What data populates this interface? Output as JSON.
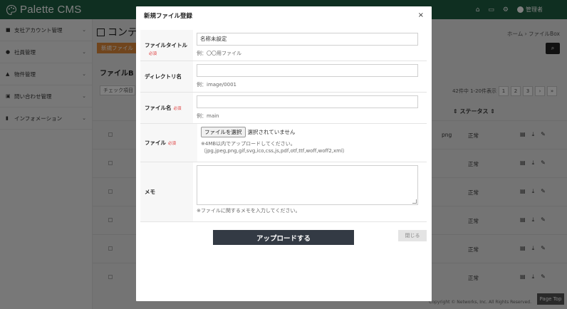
{
  "app": {
    "brand": "Palette CMS"
  },
  "topbar": {
    "user_label": "管理者",
    "icons": [
      "home-icon",
      "window-icon",
      "gear-icon",
      "user-icon"
    ]
  },
  "sidebar": {
    "items": [
      {
        "label": "支社アカウント管理",
        "icon": "people-icon"
      },
      {
        "label": "社員管理",
        "icon": "person-icon"
      },
      {
        "label": "物件管理",
        "icon": "house-icon"
      },
      {
        "label": "問い合わせ管理",
        "icon": "inbox-icon"
      },
      {
        "label": "インフォメーション",
        "icon": "doc-icon"
      }
    ]
  },
  "main": {
    "page_title": "コンテ",
    "breadcrumb": "ホーム  ›  ファイルBox",
    "new_button": "新規ファイル",
    "panel_title": "ファイルB",
    "check_select": "チェック項目",
    "paging_info": "42件中 1-20件表示",
    "pages": [
      "1",
      "2",
      "3",
      "›",
      "»"
    ],
    "status_header": "ステータス",
    "rows": [
      {
        "ext": "png",
        "status": "正常"
      },
      {
        "ext": "",
        "status": "正常"
      },
      {
        "ext": "",
        "status": "正常"
      },
      {
        "ext": "",
        "status": "正常"
      },
      {
        "ext": "",
        "status": "正常"
      },
      {
        "ext": "",
        "status": "正常"
      }
    ],
    "copyright": "Copyright © Networks, Inc. All Rights Reserved.",
    "page_top": "Page Top"
  },
  "modal": {
    "title": "新規ファイル登録",
    "close_symbol": "×",
    "fields": {
      "file_title": {
        "label": "ファイルタイトル",
        "required": "必須",
        "value": "名称未設定",
        "hint": "例：〇〇用ファイル"
      },
      "directory": {
        "label": "ディレクトリ名",
        "value": "",
        "hint": "例：image/0001"
      },
      "file_name": {
        "label": "ファイル名",
        "required": "必須",
        "value": "",
        "hint": "例：main"
      },
      "file": {
        "label": "ファイル",
        "required": "必須",
        "button": "ファイルを選択",
        "state": "選択されていません",
        "hint": "※4MB以内でアップロードしてください。（jpg,jpeg,png,gif,svg,ico,css,js,pdf,otf,ttf,woff,woff2,xml）"
      },
      "memo": {
        "label": "メモ",
        "value": "",
        "hint": "※ファイルに関するメモを入力してください。"
      }
    },
    "upload_button": "アップロードする",
    "close_button": "閉じる"
  }
}
